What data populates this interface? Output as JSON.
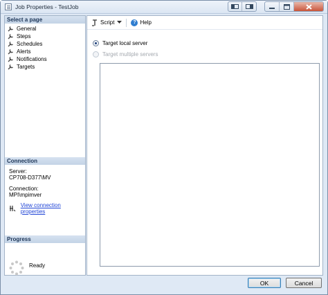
{
  "window": {
    "title": "Job Properties - TestJob",
    "accent_color": "#dfe9f5",
    "close_color": "#c9543a"
  },
  "sidebar": {
    "select_page_header": "Select a page",
    "pages": [
      {
        "label": "General",
        "icon": "wrench-icon"
      },
      {
        "label": "Steps",
        "icon": "wrench-icon"
      },
      {
        "label": "Schedules",
        "icon": "wrench-icon"
      },
      {
        "label": "Alerts",
        "icon": "wrench-icon"
      },
      {
        "label": "Notifications",
        "icon": "wrench-icon"
      },
      {
        "label": "Targets",
        "icon": "wrench-icon"
      }
    ],
    "connection": {
      "header": "Connection",
      "server_label": "Server:",
      "server_value": "CP708-D377\\MV",
      "connection_label": "Connection:",
      "connection_value": "MPI\\mpimver",
      "link_text": "View connection properties",
      "link_color": "#1f44d6"
    },
    "progress": {
      "header": "Progress",
      "status": "Ready"
    }
  },
  "toolbar": {
    "script_label": "Script",
    "help_label": "Help"
  },
  "targets": {
    "local_label": "Target local server",
    "multiple_label": "Target multiple servers",
    "selected": "local"
  },
  "buttons": {
    "ok": "OK",
    "cancel": "Cancel"
  }
}
